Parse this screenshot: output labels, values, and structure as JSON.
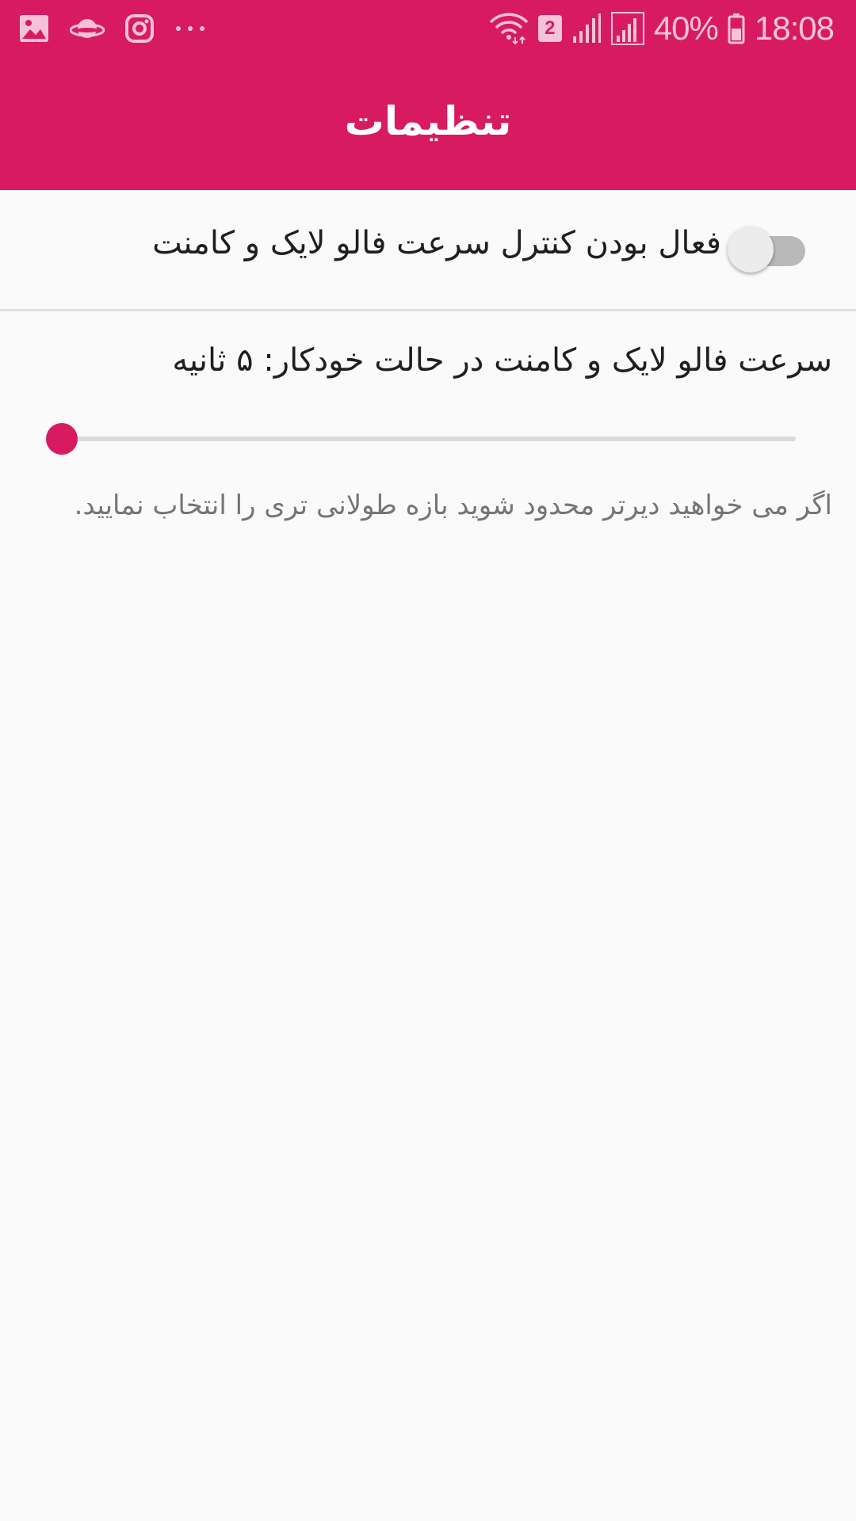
{
  "status_bar": {
    "left_icons": [
      "gallery-icon",
      "planet-icon",
      "instagram-icon",
      "more-dots-icon"
    ],
    "right_icons": [
      "wifi-data-icon",
      "sim2-badge",
      "signal-icon",
      "signal-icon"
    ],
    "sim_number": "2",
    "battery_percent": "40%",
    "time": "18:08"
  },
  "app_bar": {
    "title": "تنظیمات"
  },
  "settings": {
    "speed_control_toggle": {
      "label": "فعال بودن کنترل سرعت فالو لایک و کامنت",
      "enabled": false
    },
    "auto_speed": {
      "label": "سرعت فالو لایک و کامنت در حالت خودکار: ۵ ثانیه",
      "slider_fraction": 0.0
    },
    "hint": "اگر می خواهید دیرتر محدود شوید بازه طولانی تری را انتخاب نمایید."
  },
  "colors": {
    "accent": "#d81b60",
    "background": "#fafafa",
    "primary_text": "#1f1f1f",
    "secondary_text": "#757575"
  }
}
